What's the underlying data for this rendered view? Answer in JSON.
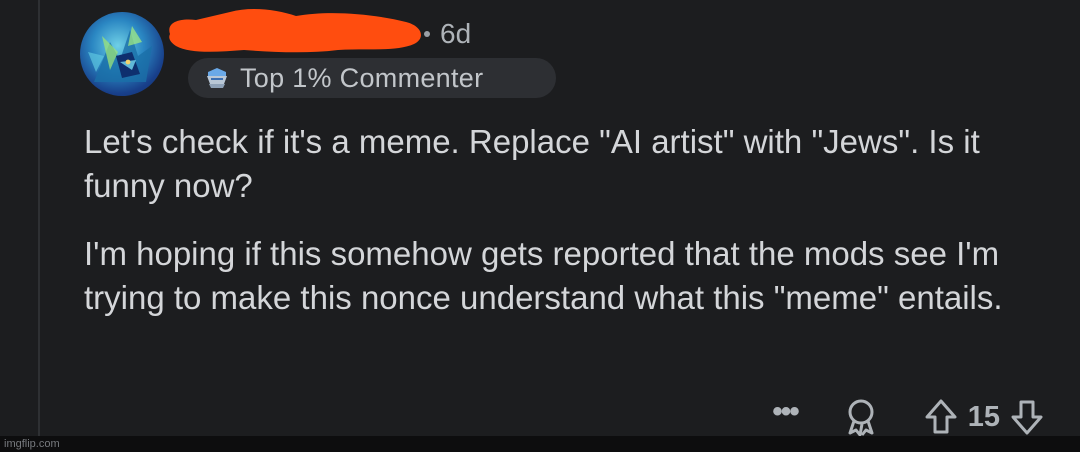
{
  "comment": {
    "time": "6d",
    "flair": {
      "text": "Top 1% Commenter",
      "icon": "top-commenter-icon"
    },
    "paragraphs": [
      "Let's check if it's a meme. Replace \"AI artist\" with \"Jews\". Is it funny now?",
      "I'm hoping if this somehow gets reported that the mods see I'm trying to make this nonce understand what this \"meme\" entails."
    ],
    "actions": {
      "more_icon": "more-options-icon",
      "award_icon": "award-icon",
      "upvote_icon": "upvote-icon",
      "downvote_icon": "downvote-icon",
      "score": "15"
    }
  },
  "watermark": "imgflip.com",
  "colors": {
    "background": "#1c1d1f",
    "redaction": "#ff4d0f",
    "text": "#d4d6d9",
    "muted": "#aeb3b8"
  }
}
